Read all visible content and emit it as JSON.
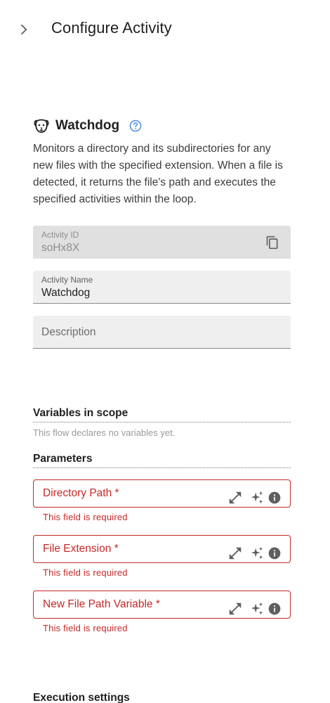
{
  "header": {
    "title": "Configure Activity"
  },
  "activity": {
    "name": "Watchdog",
    "description": "Monitors a directory and its subdirectories for any new files with the specified extension. When a file is detected, it returns the file's path and executes the specified activities within the loop."
  },
  "fields": {
    "activity_id": {
      "label": "Activity ID",
      "value": "soHx8X"
    },
    "activity_name": {
      "label": "Activity Name",
      "value": "Watchdog"
    },
    "description": {
      "placeholder": "Description"
    }
  },
  "variables": {
    "title": "Variables in scope",
    "empty_text": "This flow declares no variables yet."
  },
  "parameters": {
    "title": "Parameters",
    "items": [
      {
        "label": "Directory Path *",
        "error": "This field is required"
      },
      {
        "label": "File Extension *",
        "error": "This field is required"
      },
      {
        "label": "New File Path Variable *",
        "error": "This field is required"
      }
    ]
  },
  "execution": {
    "title": "Execution settings"
  },
  "colors": {
    "error": "#c62828",
    "help": "#4a90d9",
    "field_bg": "#efefef"
  },
  "icons": [
    "chevron-right-icon",
    "dog-icon",
    "help-icon",
    "copy-icon",
    "expand-icon",
    "sparkle-icon",
    "info-icon"
  ]
}
